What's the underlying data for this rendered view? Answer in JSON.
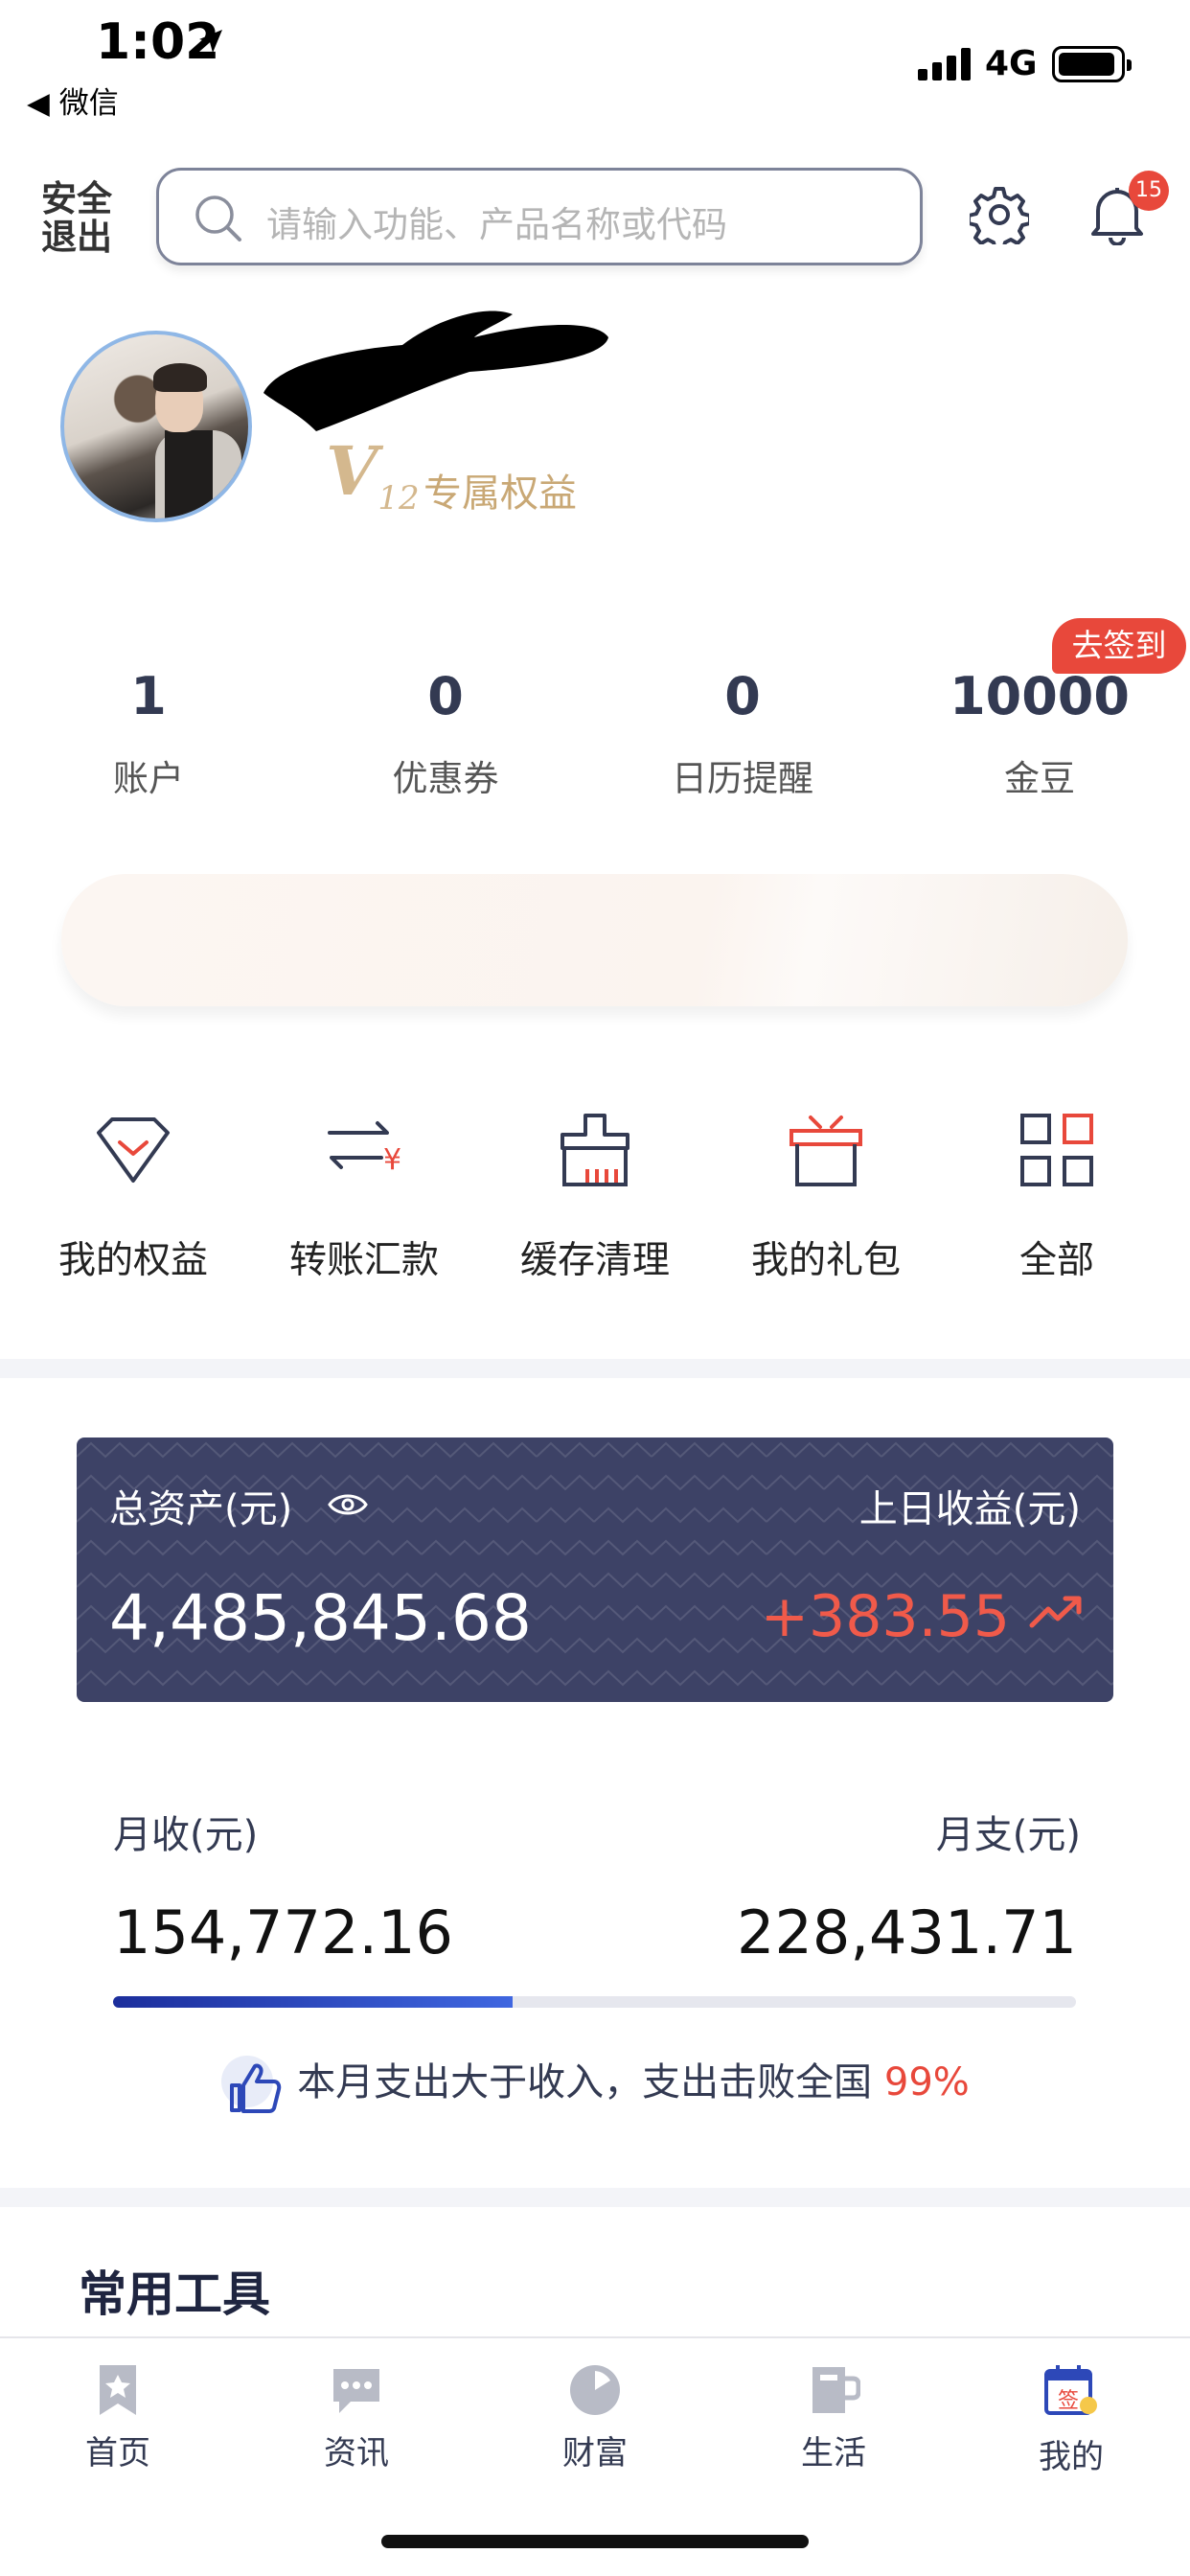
{
  "status_bar": {
    "time": "1:02",
    "back_app": "◀ 微信",
    "network": "4G"
  },
  "header": {
    "logout_label": "安全退出",
    "search_placeholder": "请输入功能、产品名称或代码",
    "notification_count": "15"
  },
  "profile": {
    "vip_level": "V",
    "vip_level_num": "12",
    "vip_text": "专属权益"
  },
  "stats": [
    {
      "value": "1",
      "label": "账户"
    },
    {
      "value": "0",
      "label": "优惠券"
    },
    {
      "value": "0",
      "label": "日历提醒"
    },
    {
      "value": "10000",
      "label": "金豆"
    }
  ],
  "checkin_label": "去签到",
  "quick_menu": [
    {
      "label": "我的权益",
      "icon": "diamond-icon"
    },
    {
      "label": "转账汇款",
      "icon": "transfer-icon"
    },
    {
      "label": "缓存清理",
      "icon": "broom-icon"
    },
    {
      "label": "我的礼包",
      "icon": "gift-icon"
    },
    {
      "label": "全部",
      "icon": "grid-icon"
    }
  ],
  "assets": {
    "total_label": "总资产(元)",
    "total_value": "4,485,845.68",
    "yesterday_label": "上日收益(元)",
    "yesterday_value": "+383.55"
  },
  "monthly": {
    "income_label": "月收(元)",
    "income_value": "154,772.16",
    "expense_label": "月支(元)",
    "expense_value": "228,431.71",
    "bar_fill_fraction": 0.415,
    "tip_text": "本月支出大于收入，支出击败全国 ",
    "tip_percent": "99%"
  },
  "tools_title": "常用工具",
  "tabbar": [
    {
      "label": "首页",
      "icon": "bookmark-icon"
    },
    {
      "label": "资讯",
      "icon": "chat-icon"
    },
    {
      "label": "财富",
      "icon": "pie-icon"
    },
    {
      "label": "生活",
      "icon": "cup-icon"
    },
    {
      "label": "我的",
      "icon": "calendar-sign-icon",
      "active": true
    }
  ],
  "colors": {
    "accent_red": "#e8483b",
    "card_navy": "#3d4266",
    "text_navy": "#333a52",
    "vip_gold": "#c9a875"
  }
}
